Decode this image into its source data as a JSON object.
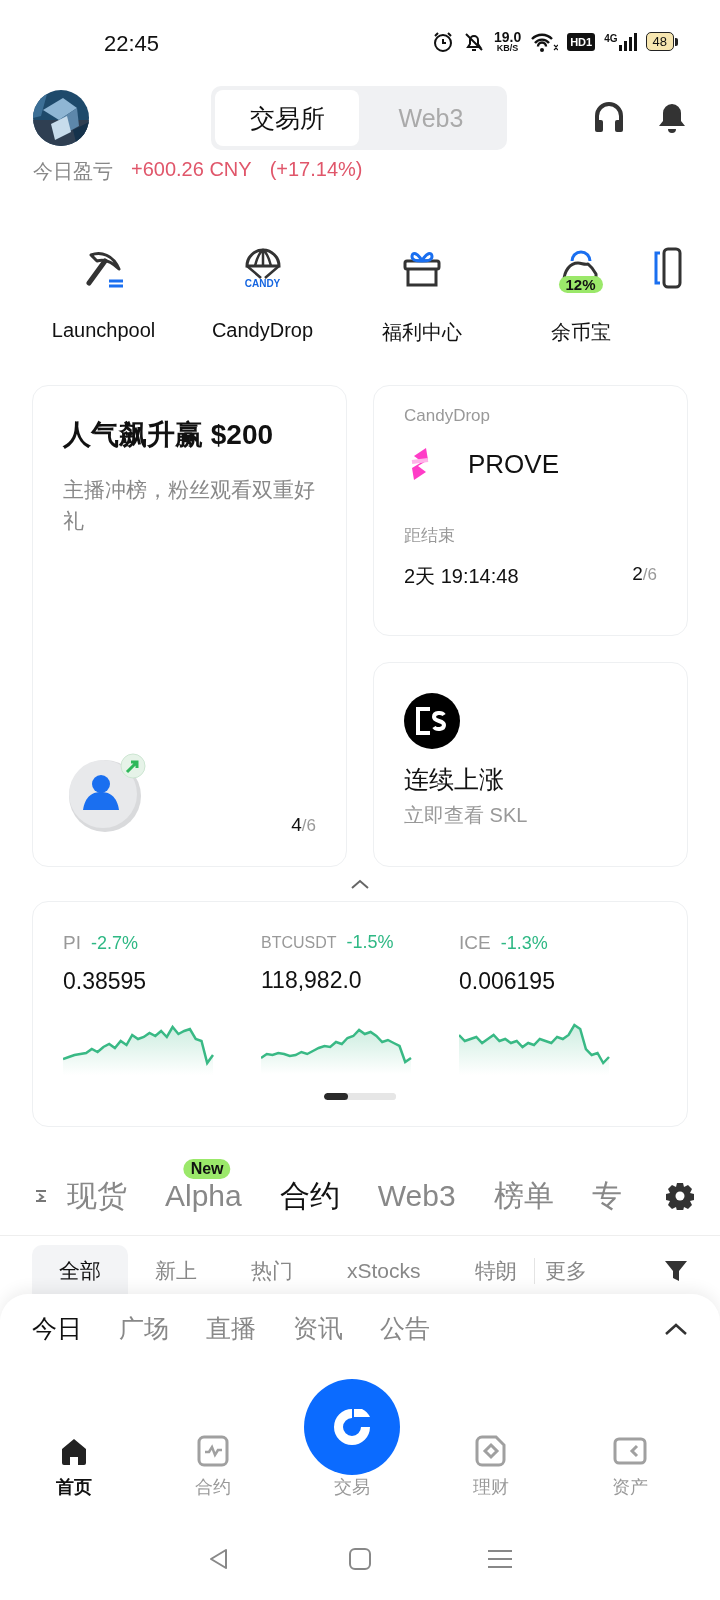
{
  "status_bar": {
    "time": "22:45",
    "net_speed": "19.0",
    "net_unit": "KB/S",
    "hd": "HD1",
    "network": "4G",
    "battery": "48"
  },
  "header": {
    "segments": [
      {
        "label": "交易所",
        "selected": true
      },
      {
        "label": "Web3",
        "selected": false
      }
    ]
  },
  "pnl": {
    "label": "今日盈亏",
    "amount": "+600.26 CNY",
    "percent": "(+17.14%)"
  },
  "shortcuts": [
    {
      "kind": "pickaxe",
      "label": "Launchpool"
    },
    {
      "kind": "parachute",
      "label": "CandyDrop",
      "icon_text": "CANDY"
    },
    {
      "kind": "gift",
      "label": "福利中心"
    },
    {
      "kind": "savings",
      "label": "余币宝",
      "badge": "12%"
    },
    {
      "kind": "partial"
    }
  ],
  "promo": {
    "title": "人气飙升赢 $200",
    "subtitle": "主播冲榜，粉丝观看双重好礼",
    "page_current": "4",
    "page_total": "/6"
  },
  "candydrop": {
    "label": "CandyDrop",
    "token": "PROVE",
    "countdown_label": "距结束",
    "countdown": "2天 19:14:48",
    "page_current": "2",
    "page_total": "/6"
  },
  "highlight": {
    "title": "连续上涨",
    "subtitle": "立即查看 SKL"
  },
  "tickers": [
    {
      "symbol": "PI",
      "change": "-2.7%",
      "price": "0.38595"
    },
    {
      "symbol": "BTCUSDT",
      "change": "-1.5%",
      "price": "118,982.0"
    },
    {
      "symbol": "ICE",
      "change": "-1.3%",
      "price": "0.006195"
    }
  ],
  "market_tabs": [
    {
      "label": "现货",
      "selected": false
    },
    {
      "label": "Alpha",
      "selected": false,
      "badge": "New"
    },
    {
      "label": "合约",
      "selected": true
    },
    {
      "label": "Web3",
      "selected": false
    },
    {
      "label": "榜单",
      "selected": false
    },
    {
      "label": "专",
      "selected": false
    }
  ],
  "filter_tabs": [
    {
      "label": "全部",
      "selected": true
    },
    {
      "label": "新上",
      "selected": false
    },
    {
      "label": "热门",
      "selected": false
    },
    {
      "label": "xStocks",
      "selected": false
    },
    {
      "label": "特朗",
      "selected": false
    }
  ],
  "filter_more": "更多",
  "feed_tabs": [
    {
      "label": "今日",
      "selected": true
    },
    {
      "label": "广场",
      "selected": false
    },
    {
      "label": "直播",
      "selected": false
    },
    {
      "label": "资讯",
      "selected": false
    },
    {
      "label": "公告",
      "selected": false
    }
  ],
  "nav": [
    {
      "kind": "home",
      "label": "首页",
      "selected": true
    },
    {
      "kind": "chart",
      "label": "合约",
      "selected": false
    },
    {
      "kind": "trade",
      "label": "交易",
      "selected": false
    },
    {
      "kind": "earn",
      "label": "理财",
      "selected": false
    },
    {
      "kind": "wallet",
      "label": "资产",
      "selected": false
    }
  ]
}
